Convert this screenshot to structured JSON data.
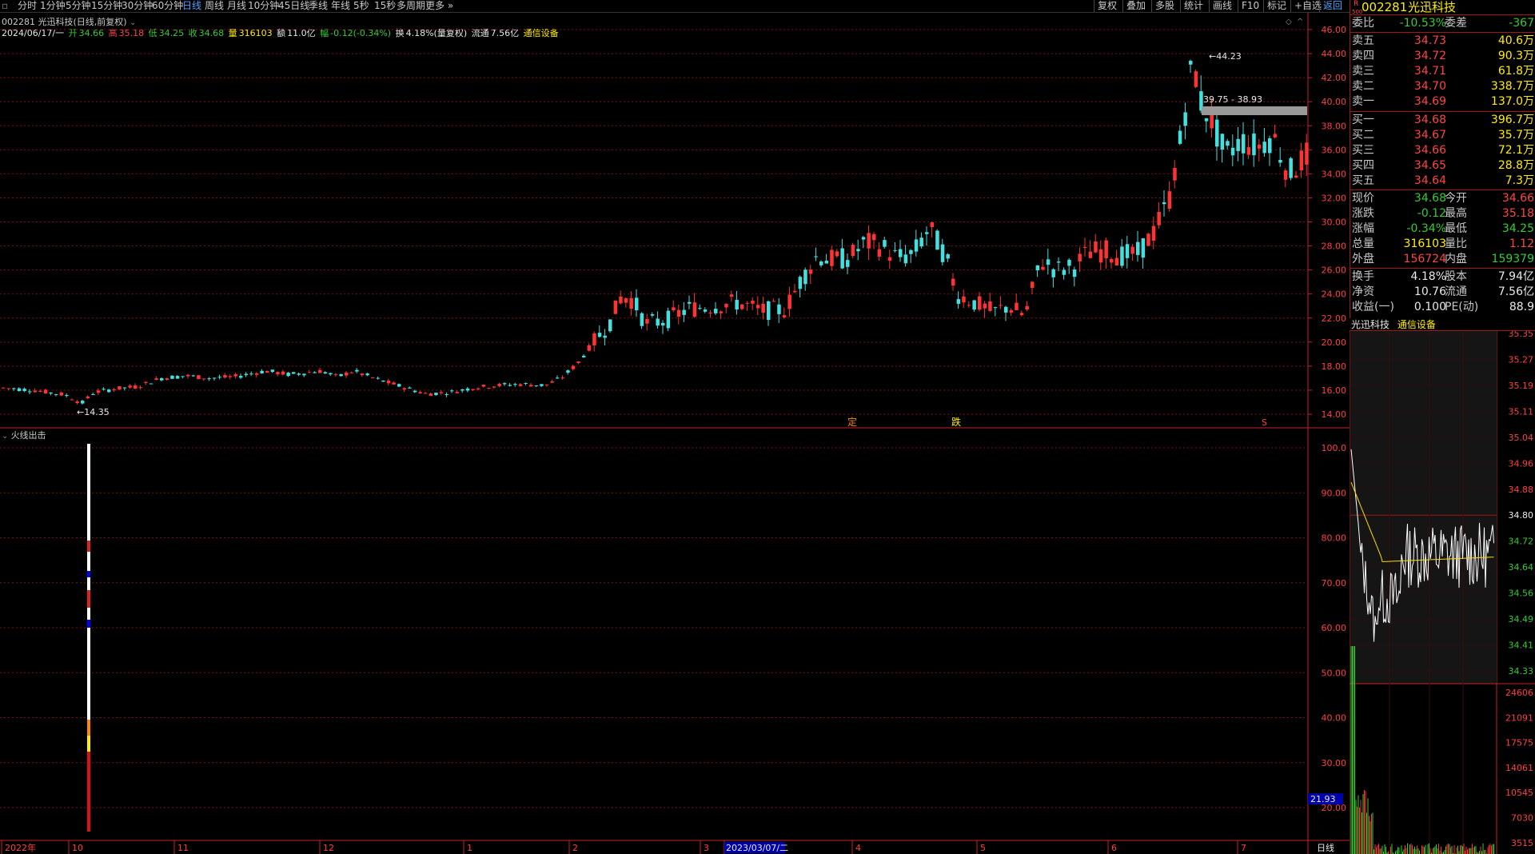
{
  "toolbar": {
    "items": [
      "分时",
      "1分钟",
      "5分钟",
      "15分钟",
      "30分钟",
      "60分钟",
      "日线",
      "周线",
      "月线",
      "10分钟",
      "45日线",
      "季线",
      "年线",
      "5秒",
      "15秒",
      "多周期",
      "更多"
    ],
    "active": "日线",
    "right_items": [
      "复权",
      "叠加",
      "多股",
      "统计",
      "画线",
      "F10",
      "标记",
      "+自选",
      "返回"
    ]
  },
  "header": {
    "code_name": "002281 光迅科技(日线,前复权)",
    "date": "2024/06/17/一",
    "open_label": "开",
    "open": "34.66",
    "high_label": "高",
    "high": "35.18",
    "low_label": "低",
    "low": "34.25",
    "close_label": "收",
    "close": "34.68",
    "vol_label": "量",
    "vol": "316103",
    "amount_label": "额",
    "amount": "11.0亿",
    "change_label": "幅",
    "change": "-0.12(-0.34%)",
    "turnover_label": "换",
    "turnover": "4.18%(量复权)",
    "float_label": "流通",
    "float": "7.56亿",
    "industry": "通信设备"
  },
  "indicator": {
    "name": "火线出击"
  },
  "main_yaxis": [
    "46.00",
    "44.00",
    "42.00",
    "40.00",
    "38.00",
    "36.00",
    "34.00",
    "32.00",
    "30.00",
    "28.00",
    "26.00",
    "24.00",
    "22.00",
    "20.00",
    "18.00",
    "16.00",
    "14.00"
  ],
  "sub_yaxis": [
    "100.0",
    "90.00",
    "80.00",
    "70.00",
    "60.00",
    "50.00",
    "40.00",
    "30.00",
    "20.00"
  ],
  "sub_marker": "21.93",
  "xaxis": {
    "labels": [
      "2022年",
      "10",
      "11",
      "12",
      "1",
      "2",
      "3",
      "2023/03/07/二",
      "4",
      "5",
      "6",
      "7"
    ],
    "period_label": "日线"
  },
  "annotations": {
    "high": "44.23",
    "low": "14.35",
    "range": "39.75 - 38.93",
    "marker1": "定",
    "marker2": "跌",
    "marker3": "S"
  },
  "quote": {
    "title_code": "002281",
    "title_name": "光迅科技",
    "weibi_label": "委比",
    "weibi": "-10.53%",
    "weicha_label": "委差",
    "weicha": "-367",
    "asks": [
      {
        "label": "卖五",
        "price": "34.73",
        "vol": "40.6万"
      },
      {
        "label": "卖四",
        "price": "34.72",
        "vol": "90.3万"
      },
      {
        "label": "卖三",
        "price": "34.71",
        "vol": "61.8万"
      },
      {
        "label": "卖二",
        "price": "34.70",
        "vol": "338.7万"
      },
      {
        "label": "卖一",
        "price": "34.69",
        "vol": "137.0万"
      }
    ],
    "bids": [
      {
        "label": "买一",
        "price": "34.68",
        "vol": "396.7万"
      },
      {
        "label": "买二",
        "price": "34.67",
        "vol": "35.7万"
      },
      {
        "label": "买三",
        "price": "34.66",
        "vol": "72.1万"
      },
      {
        "label": "买四",
        "price": "34.65",
        "vol": "28.8万"
      },
      {
        "label": "买五",
        "price": "34.64",
        "vol": "7.3万"
      }
    ],
    "stats": [
      {
        "l1": "现价",
        "v1": "34.68",
        "l2": "今开",
        "v2": "34.66"
      },
      {
        "l1": "涨跌",
        "v1": "-0.12",
        "l2": "最高",
        "v2": "35.18"
      },
      {
        "l1": "涨幅",
        "v1": "-0.34%",
        "l2": "最低",
        "v2": "34.25"
      },
      {
        "l1": "总量",
        "v1": "316103",
        "l2": "量比",
        "v2": "1.12"
      },
      {
        "l1": "外盘",
        "v1": "156724",
        "l2": "内盘",
        "v2": "159379"
      },
      {
        "l1": "换手",
        "v1": "4.18%",
        "l2": "股本",
        "v2": "7.94亿"
      },
      {
        "l1": "净资",
        "v1": "10.76",
        "l2": "流通",
        "v2": "7.56亿"
      },
      {
        "l1": "收益(一)",
        "v1": "0.100",
        "l2": "PE(动)",
        "v2": "88.9"
      }
    ],
    "r_symbol": "R",
    "sub_symbol": "500"
  },
  "mini": {
    "name": "光迅科技",
    "industry": "通信设备",
    "yaxis": [
      "35.35",
      "35.27",
      "35.19",
      "35.11",
      "35.04",
      "34.96",
      "34.88",
      "34.80",
      "34.72",
      "34.64",
      "34.56",
      "34.49",
      "34.41",
      "34.33"
    ],
    "vol_axis": [
      "24606",
      "21091",
      "17575",
      "14061",
      "10545",
      "7030",
      "3515"
    ]
  },
  "colors": {
    "up": "#ff3333",
    "down": "#44e0e0",
    "grid": "#7a1010",
    "axis": "#cc2222"
  }
}
